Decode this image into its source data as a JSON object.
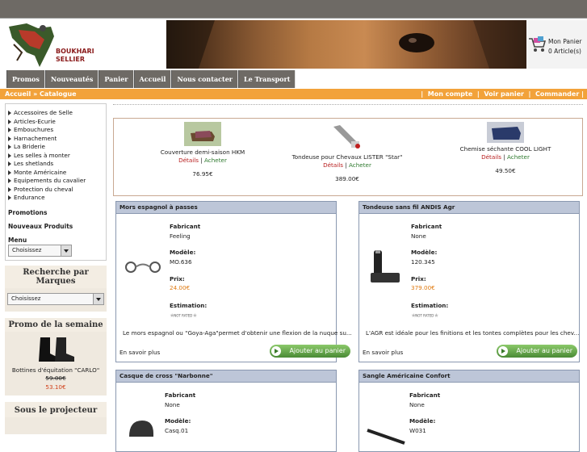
{
  "header": {
    "logo_text_line1": "BOUKHARI",
    "logo_text_line2": "SELLIER",
    "cart_title": "Mon Panier",
    "cart_count": "0 Article(s)"
  },
  "nav": [
    "Promos",
    "Nouveautés",
    "Panier",
    "Accueil",
    "Nous contacter",
    "Le Transport"
  ],
  "breadcrumb": "Accueil » Catalogue",
  "account": {
    "account": "Mon compte",
    "cart": "Voir panier",
    "order": "Commander"
  },
  "sidebar": {
    "categories": [
      "Accessoires de Selle",
      "Articles-Ecurie",
      "Embouchures",
      "Harnachement",
      "La Briderie",
      "Les selles à monter",
      "Les shetlands",
      "Monte Américaine",
      "Equipements du cavalier",
      "Protection du cheval",
      "Endurance"
    ],
    "promotions": "Promotions",
    "new_products": "Nouveaux Produits",
    "menu_label": "Menu",
    "menu_select": "Choisissez",
    "brand_title": "Recherche par Marques",
    "brand_select": "Choisissez",
    "promo_title": "Promo de la semaine",
    "promo_product": "Bottines d'équitation \"CARLO\"",
    "promo_old_price": "59.00€",
    "promo_new_price": "53.10€",
    "spotlight_title": "Sous le projecteur"
  },
  "featured": [
    {
      "name": "Couverture demi-saison HKM",
      "details": "Détails",
      "buy": "Acheter",
      "price": "76.95€"
    },
    {
      "name": "Tondeuse pour Chevaux LISTER \"Star\"",
      "details": "Détails",
      "buy": "Acheter",
      "price": "389.00€"
    },
    {
      "name": "Chemise séchante COOL LIGHT",
      "details": "Détails",
      "buy": "Acheter",
      "price": "49.50€"
    }
  ],
  "labels": {
    "maker": "Fabricant",
    "model": "Modèle:",
    "price": "Prix:",
    "estimate": "Estimation:",
    "not_rated": "NOT RATED",
    "more": "En savoir plus",
    "add": "Ajouter au panier"
  },
  "products": [
    {
      "title": "Mors espagnol à passes",
      "maker": "Feeling",
      "model": "MO.636",
      "price": "24.00€",
      "desc": "Le mors espagnol ou \"Goya-Aga\"permet d'obtenir une flexion de la nuque su..."
    },
    {
      "title": "Tondeuse sans fil ANDIS Agr",
      "maker": "None",
      "model": "120.345",
      "price": "379.00€",
      "desc": "L'AGR est idéale pour les finitions et les tontes complètes pour les chev..."
    },
    {
      "title": "Casque de cross \"Narbonne\"",
      "maker": "None",
      "model": "Casq.01"
    },
    {
      "title": "Sangle Américaine Confort",
      "maker": "None",
      "model": "W031"
    }
  ],
  "colors": {
    "nav_bg": "#6e6a65",
    "orange": "#f2a23a",
    "card_header": "#bdc6d8",
    "price": "#e07a10",
    "details": "#b82020",
    "buy": "#2f7a2f"
  }
}
